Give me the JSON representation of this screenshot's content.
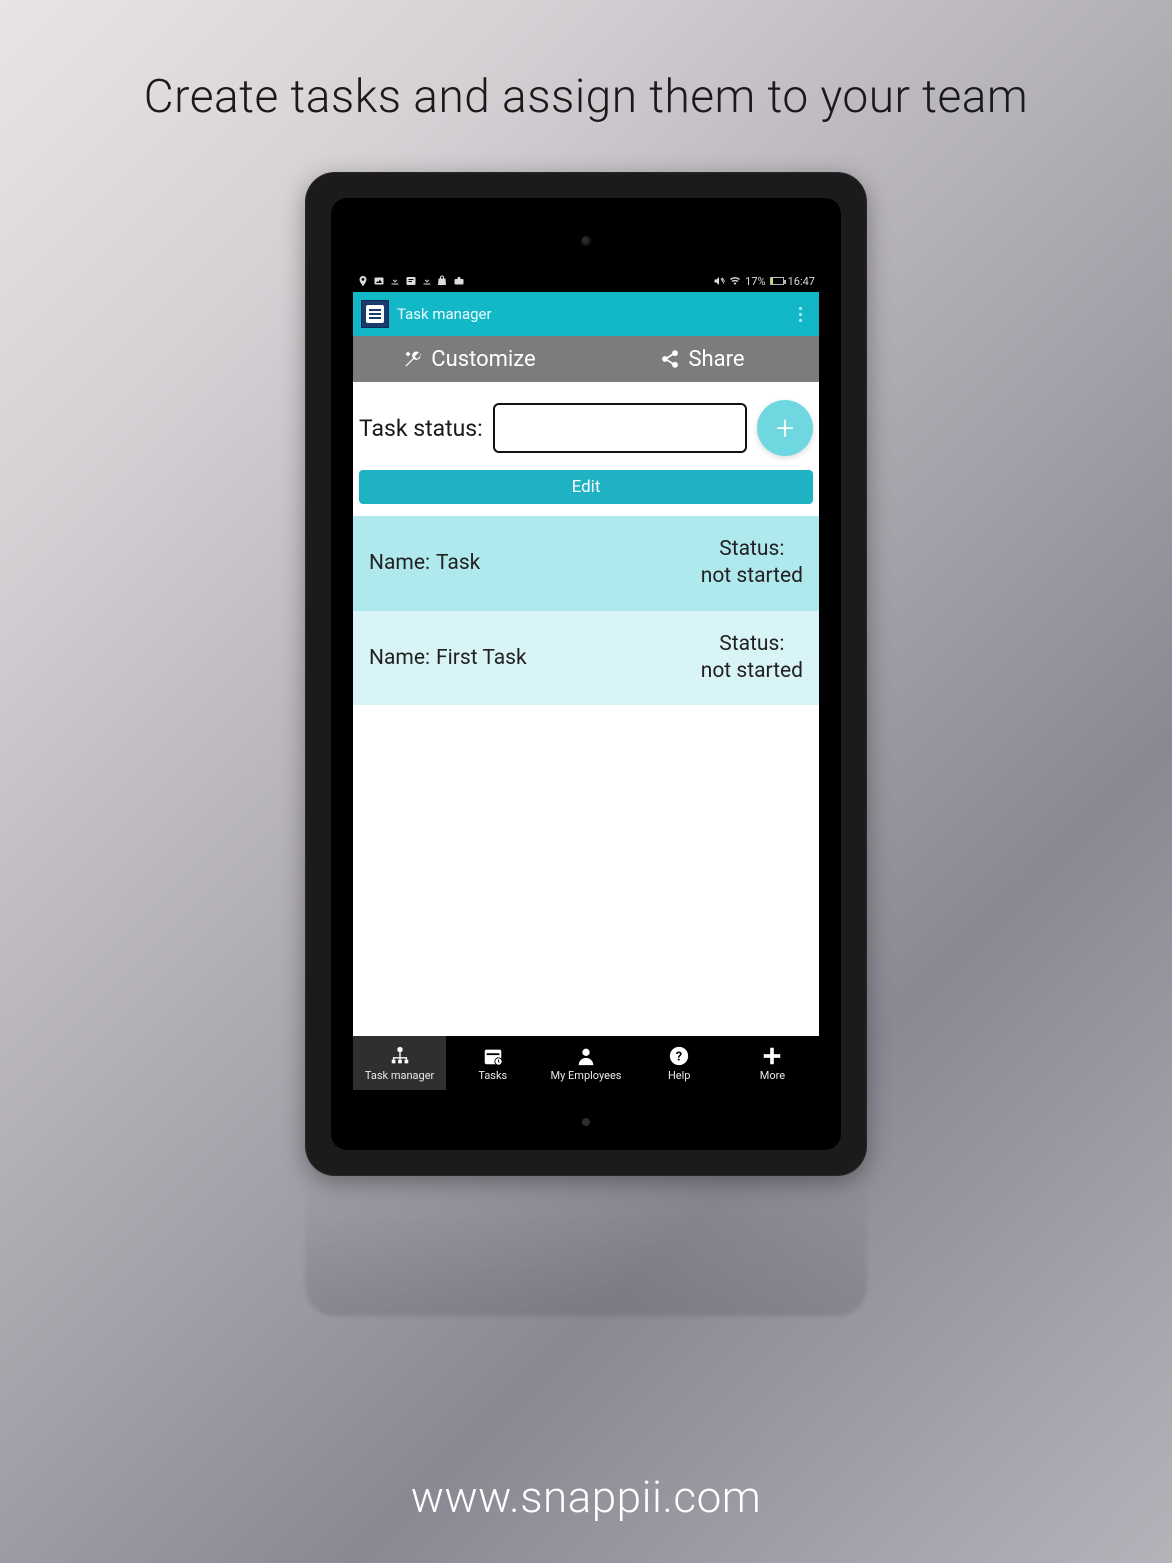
{
  "page": {
    "headline": "Create tasks and assign them to your team",
    "footer": "www.snappii.com"
  },
  "status_bar": {
    "battery_percent": "17%",
    "clock": "16:47"
  },
  "app_bar": {
    "title": "Task manager"
  },
  "toolbar": {
    "customize_label": "Customize",
    "share_label": "Share"
  },
  "filter": {
    "label": "Task status:",
    "value": ""
  },
  "buttons": {
    "add": "+",
    "edit": "Edit"
  },
  "tasks": [
    {
      "name_label": "Name:",
      "name": "Task",
      "status_label": "Status:",
      "status": "not started"
    },
    {
      "name_label": "Name:",
      "name": "First Task",
      "status_label": "Status:",
      "status": "not started"
    }
  ],
  "bottom_nav": [
    {
      "label": "Task manager",
      "active": true
    },
    {
      "label": "Tasks",
      "active": false
    },
    {
      "label": "My Employees",
      "active": false
    },
    {
      "label": "Help",
      "active": false
    },
    {
      "label": "More",
      "active": false
    }
  ]
}
